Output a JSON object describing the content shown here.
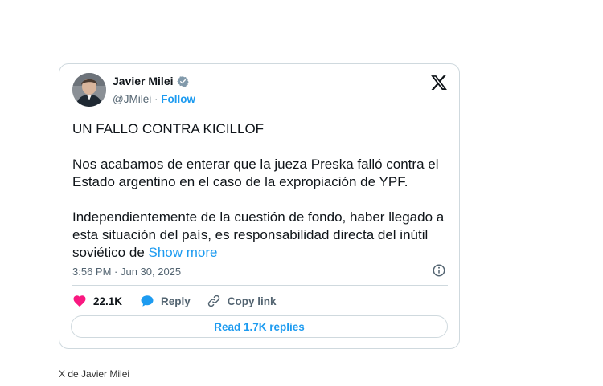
{
  "tweet": {
    "author": {
      "name": "Javier Milei",
      "handle": "@JMilei",
      "separator": "·",
      "follow_label": "Follow",
      "verified": true,
      "avatar_icon": "person-avatar"
    },
    "logo_icon": "x-logo-icon",
    "text": {
      "paragraph_1": "UN FALLO CONTRA KICILLOF",
      "paragraph_2": "Nos acabamos de enterar que la jueza Preska falló contra el Estado argentino en el caso de la expropiación de YPF.",
      "paragraph_3": "Independientemente de la cuestión de fondo, haber llegado a esta situación del país, es responsabilidad directa del inútil soviético de",
      "show_more": "Show more"
    },
    "timestamp": "3:56 PM · Jun 30, 2025",
    "info_icon": "info-icon",
    "actions": {
      "likes": "22.1K",
      "reply_label": "Reply",
      "copy_link_label": "Copy link"
    },
    "read_replies_label": "Read 1.7K replies"
  },
  "caption": "X de Javier Milei",
  "colors": {
    "accent": "#1d9bf0",
    "heart": "#f91880",
    "text": "#0f1419",
    "muted": "#536471",
    "border": "#cfd9de"
  }
}
